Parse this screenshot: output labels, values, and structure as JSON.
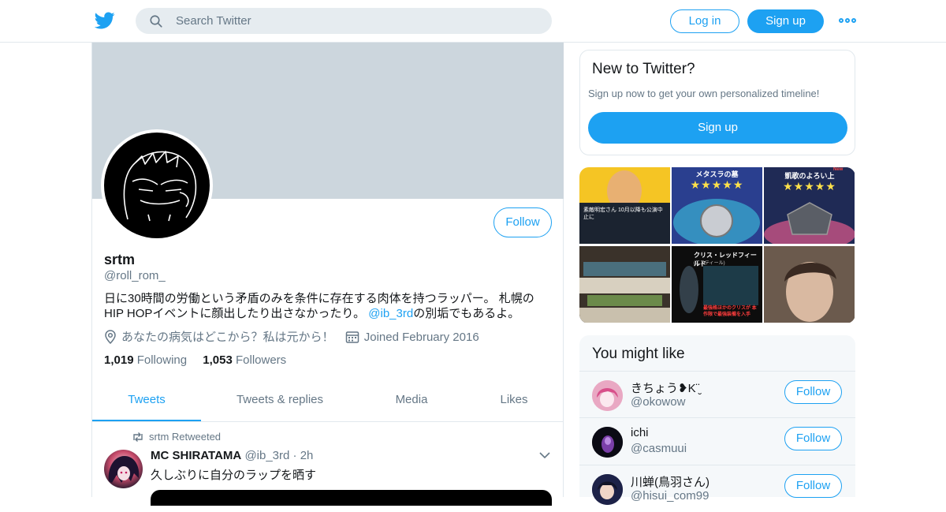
{
  "header": {
    "logo_icon": "twitter-bird-icon",
    "search_placeholder": "Search Twitter",
    "login_label": "Log in",
    "signup_label": "Sign up",
    "more_icon": "more-dots-icon",
    "accent": "#1da1f2"
  },
  "profile": {
    "name": "srtm",
    "handle": "@roll_rom_",
    "follow_label": "Follow",
    "bio_before": "日に30時間の労働という矛盾のみを条件に存在する肉体を持つラッパー。 札幌のHIP HOPイベントに顔出したり出さなかったり。 ",
    "bio_link": "@ib_3rd",
    "bio_after": "の別垢でもあるよ。",
    "location": "あなたの病気はどこから？私は元から！",
    "joined": "Joined February 2016",
    "following_count": "1,019",
    "following_label": "Following",
    "followers_count": "1,053",
    "followers_label": "Followers"
  },
  "tabs": [
    {
      "label": "Tweets",
      "active": true
    },
    {
      "label": "Tweets & replies",
      "active": false
    },
    {
      "label": "Media",
      "active": false
    },
    {
      "label": "Likes",
      "active": false
    }
  ],
  "tweet": {
    "retweet_label": "srtm Retweeted",
    "author_name": "MC SHIRATAMA",
    "author_handle": "@ib_3rd",
    "separator": "·",
    "time": "2h",
    "text": "久しぶりに自分のラップを晒す"
  },
  "new_to_twitter": {
    "title": "New to Twitter?",
    "subtitle": "Sign up now to get your own personalized timeline!",
    "button": "Sign up"
  },
  "media_tiles": [
    {
      "caption": "",
      "overlay": "素敵明宏さん 10月以降も公演中止に"
    },
    {
      "caption": "メタスラの墓",
      "overlay": "★★★★★"
    },
    {
      "caption": "凱歌のよろい上",
      "badge": "New",
      "overlay": "★★★★★"
    },
    {
      "caption": "",
      "overlay": ""
    },
    {
      "caption": "クリス・レッドフィールド",
      "sub": "(エスティール)",
      "overlay": "最強格ほかのクリスが 本作限で最強装備を入手"
    },
    {
      "caption": "",
      "overlay": ""
    }
  ],
  "you_might_like": {
    "title": "You might like",
    "users": [
      {
        "name": "きちょう❥K¨̮",
        "handle": "@okowow",
        "follow": "Follow"
      },
      {
        "name": "ichi",
        "handle": "@casmuui",
        "follow": "Follow"
      },
      {
        "name": "川蝉(鳥羽さん)",
        "handle": "@hisui_com99",
        "follow": "Follow"
      }
    ]
  }
}
